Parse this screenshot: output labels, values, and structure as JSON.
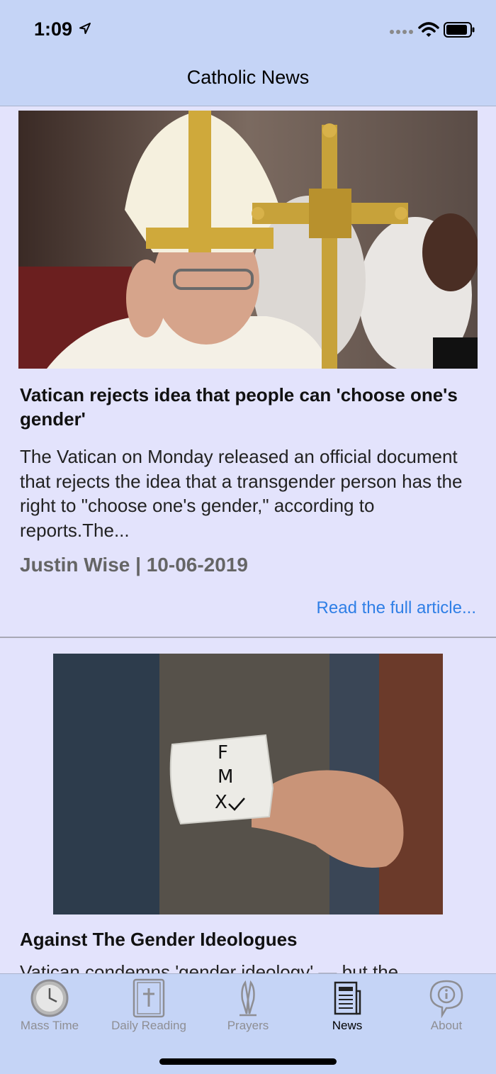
{
  "status_bar": {
    "time": "1:09"
  },
  "nav": {
    "title": "Catholic News"
  },
  "articles": [
    {
      "title": "Vatican rejects idea that people can 'choose one's gender'",
      "summary": "The Vatican on Monday released an official document that rejects the idea that a transgender person has the right to \"choose one's gender,\" according to reports.The...",
      "meta": "Justin Wise | 10-06-2019",
      "read_more": "Read the full article..."
    },
    {
      "title": "Against The Gender Ideologues",
      "summary": "Vatican condemns 'gender ideology' — but the",
      "note_letters": [
        "F",
        "M",
        "X"
      ]
    }
  ],
  "tabs": [
    {
      "label": "Mass Time",
      "icon": "clock-icon"
    },
    {
      "label": "Daily Reading",
      "icon": "bible-icon"
    },
    {
      "label": "Prayers",
      "icon": "praying-hands-icon"
    },
    {
      "label": "News",
      "icon": "newspaper-icon",
      "active": true
    },
    {
      "label": "About",
      "icon": "info-icon"
    }
  ],
  "colors": {
    "bar_background": "#c5d4f6",
    "page_background": "#e3e3fc",
    "link": "#2f7fe6",
    "meta_text": "#656565"
  }
}
